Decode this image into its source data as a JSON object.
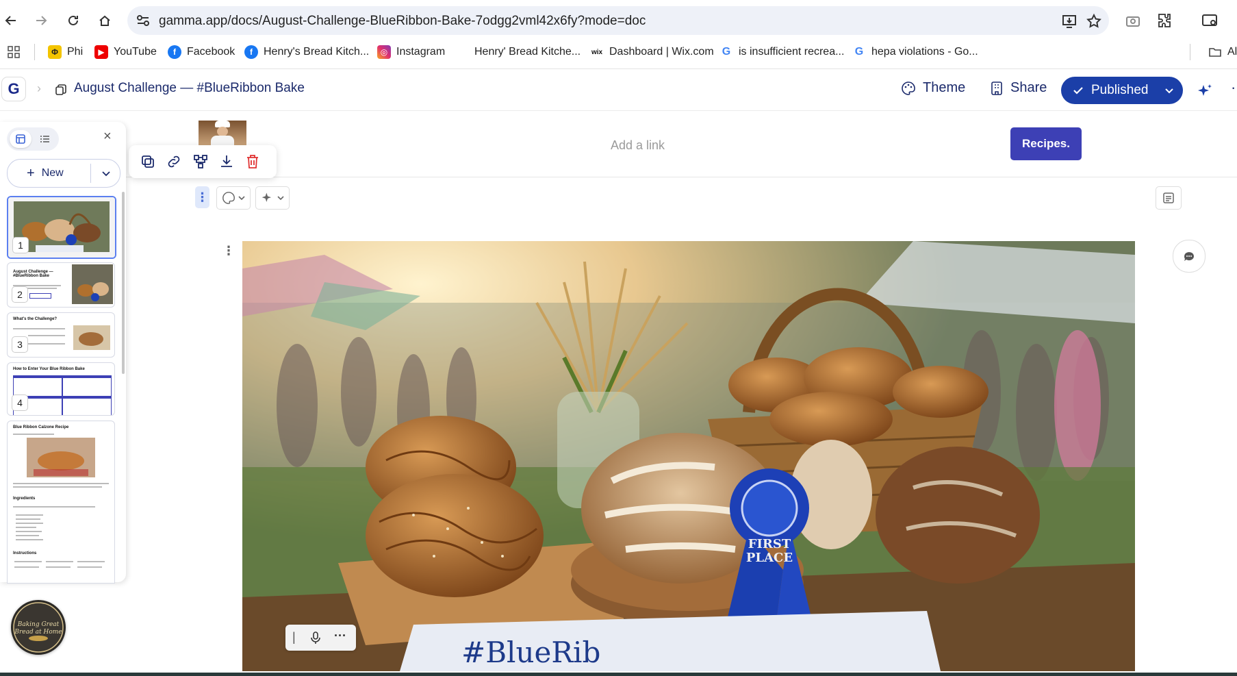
{
  "browser": {
    "url": "gamma.app/docs/August-Challenge-BlueRibbon-Bake-7odgg2vml42x6fy?mode=doc",
    "bookmarks": [
      {
        "label": "Phi",
        "icon": "phi-icon"
      },
      {
        "label": "YouTube",
        "icon": "youtube-icon"
      },
      {
        "label": "Facebook",
        "icon": "facebook-icon"
      },
      {
        "label": "Henry's Bread Kitch...",
        "icon": "facebook-icon"
      },
      {
        "label": "Instagram",
        "icon": "instagram-icon"
      },
      {
        "label": "Henry' Bread Kitche...",
        "icon": "blank-icon"
      },
      {
        "label": "Dashboard | Wix.com",
        "icon": "wix-icon"
      },
      {
        "label": "is insufficient recrea...",
        "icon": "google-icon"
      },
      {
        "label": "hepa violations - Go...",
        "icon": "google-icon"
      },
      {
        "label": "Al",
        "icon": "folder-icon"
      }
    ]
  },
  "app": {
    "logo_letter": "G",
    "doc_title": "August Challenge — #BlueRibbon Bake",
    "theme_label": "Theme",
    "share_label": "Share",
    "published_label": "Published"
  },
  "sidebar": {
    "new_label": "New",
    "slides": [
      {
        "number": "1",
        "title": ""
      },
      {
        "number": "2",
        "title": "August Challenge — #BlueRibbon Bake"
      },
      {
        "number": "3",
        "title": "What's the Challenge?"
      },
      {
        "number": "4",
        "title": "How to Enter Your Blue Ribbon Bake"
      },
      {
        "number": "",
        "title": "Blue Ribbon Calzone Recipe",
        "extra": [
          "Ingredients",
          "Instructions"
        ]
      }
    ],
    "group_logo_text": "Baking Great Bread at Home"
  },
  "doc": {
    "add_link_placeholder": "Add a link",
    "recipes_button": "Recipes.",
    "image_ribbon_text": "FIRST PLACE",
    "image_banner_text": "#BlueRib"
  },
  "colors": {
    "brand": "#1b3fa8",
    "recipes_button": "#3d40b5",
    "delete_icon": "#e03131"
  }
}
